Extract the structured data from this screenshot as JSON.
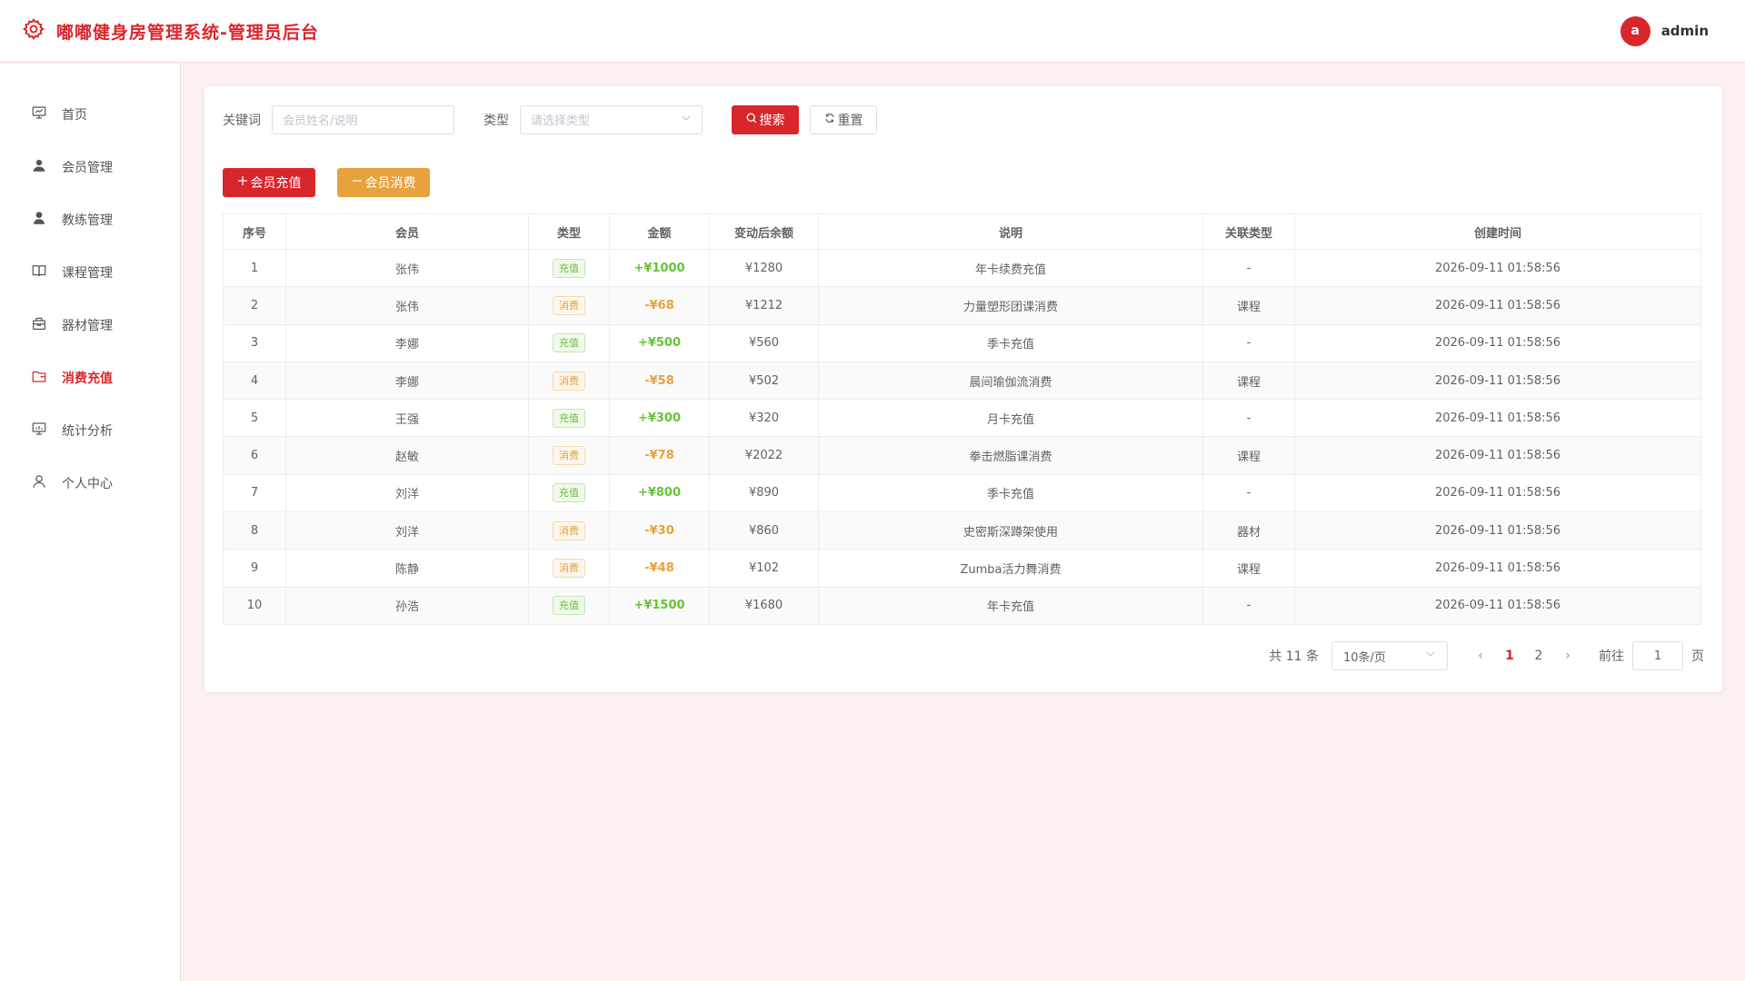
{
  "header": {
    "title": "嘟嘟健身房管理系统-管理员后台",
    "avatar_letter": "a",
    "username": "admin"
  },
  "colors": {
    "brand": "#d9262c",
    "recharge": "#67c23a",
    "consume": "#e6a23c"
  },
  "sidebar": {
    "items": [
      {
        "label": "首页",
        "icon": "presentation-board-icon",
        "active": false
      },
      {
        "label": "会员管理",
        "icon": "user-filled-icon",
        "active": false
      },
      {
        "label": "教练管理",
        "icon": "user-avatar-icon",
        "active": false
      },
      {
        "label": "课程管理",
        "icon": "open-book-icon",
        "active": false
      },
      {
        "label": "器材管理",
        "icon": "box-icon",
        "active": false
      },
      {
        "label": "消费充值",
        "icon": "wallet-folder-icon",
        "active": true
      },
      {
        "label": "统计分析",
        "icon": "chart-board-icon",
        "active": false
      },
      {
        "label": "个人中心",
        "icon": "user-outline-icon",
        "active": false
      }
    ]
  },
  "filters": {
    "keyword_label": "关键词",
    "keyword_placeholder": "会员姓名/说明",
    "type_label": "类型",
    "type_placeholder": "请选择类型",
    "search_label": "搜索",
    "reset_label": "重置"
  },
  "actions": {
    "recharge_label": "会员充值",
    "consume_label": "会员消费"
  },
  "table": {
    "columns": [
      "序号",
      "会员",
      "类型",
      "金额",
      "变动后余额",
      "说明",
      "关联类型",
      "创建时间"
    ],
    "rows": [
      {
        "no": "1",
        "member": "张伟",
        "type": "充值",
        "amount": "+¥1000",
        "balance": "¥1280",
        "desc": "年卡续费充值",
        "related": "-",
        "time": "2026-09-11 01:58:56"
      },
      {
        "no": "2",
        "member": "张伟",
        "type": "消费",
        "amount": "-¥68",
        "balance": "¥1212",
        "desc": "力量塑形团课消费",
        "related": "课程",
        "time": "2026-09-11 01:58:56"
      },
      {
        "no": "3",
        "member": "李娜",
        "type": "充值",
        "amount": "+¥500",
        "balance": "¥560",
        "desc": "季卡充值",
        "related": "-",
        "time": "2026-09-11 01:58:56"
      },
      {
        "no": "4",
        "member": "李娜",
        "type": "消费",
        "amount": "-¥58",
        "balance": "¥502",
        "desc": "晨间瑜伽流消费",
        "related": "课程",
        "time": "2026-09-11 01:58:56"
      },
      {
        "no": "5",
        "member": "王强",
        "type": "充值",
        "amount": "+¥300",
        "balance": "¥320",
        "desc": "月卡充值",
        "related": "-",
        "time": "2026-09-11 01:58:56"
      },
      {
        "no": "6",
        "member": "赵敏",
        "type": "消费",
        "amount": "-¥78",
        "balance": "¥2022",
        "desc": "拳击燃脂课消费",
        "related": "课程",
        "time": "2026-09-11 01:58:56"
      },
      {
        "no": "7",
        "member": "刘洋",
        "type": "充值",
        "amount": "+¥800",
        "balance": "¥890",
        "desc": "季卡充值",
        "related": "-",
        "time": "2026-09-11 01:58:56"
      },
      {
        "no": "8",
        "member": "刘洋",
        "type": "消费",
        "amount": "-¥30",
        "balance": "¥860",
        "desc": "史密斯深蹲架使用",
        "related": "器材",
        "time": "2026-09-11 01:58:56"
      },
      {
        "no": "9",
        "member": "陈静",
        "type": "消费",
        "amount": "-¥48",
        "balance": "¥102",
        "desc": "Zumba活力舞消费",
        "related": "课程",
        "time": "2026-09-11 01:58:56"
      },
      {
        "no": "10",
        "member": "孙浩",
        "type": "充值",
        "amount": "+¥1500",
        "balance": "¥1680",
        "desc": "年卡充值",
        "related": "-",
        "time": "2026-09-11 01:58:56"
      }
    ]
  },
  "pagination": {
    "total_text": "共 11 条",
    "page_size": "10条/页",
    "pages": [
      "1",
      "2"
    ],
    "current": "1",
    "goto_label": "前往",
    "goto_value": "1",
    "page_suffix": "页"
  }
}
